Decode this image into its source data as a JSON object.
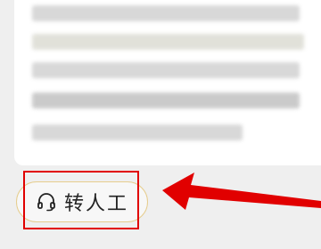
{
  "customer_service": {
    "transfer_label": "转人工",
    "button_icon": "headset-icon"
  },
  "colors": {
    "highlight": "#e10000",
    "button_border": "#e6cd8e",
    "arrow": "#e10000"
  }
}
